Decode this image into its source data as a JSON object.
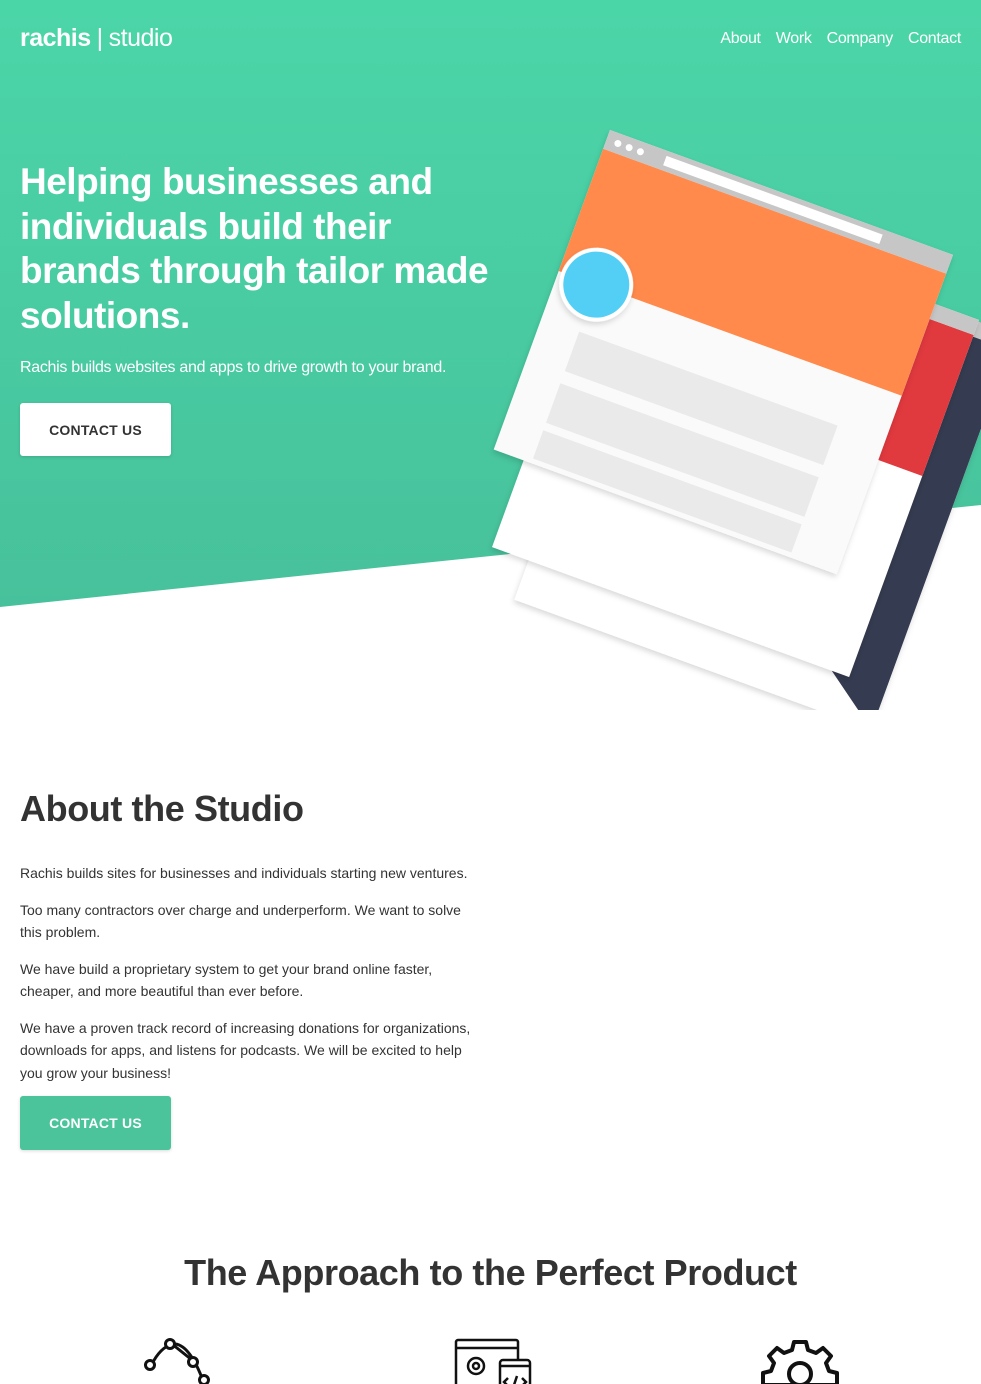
{
  "brand": {
    "name_bold": "rachis",
    "separator": "|",
    "name_light": "studio"
  },
  "nav": {
    "items": [
      {
        "label": "About"
      },
      {
        "label": "Work"
      },
      {
        "label": "Company"
      },
      {
        "label": "Contact"
      }
    ]
  },
  "hero": {
    "title": "Helping businesses and individuals build their brands through tailor made solutions.",
    "subtitle": "Rachis builds websites and apps to drive growth to your brand.",
    "cta_label": "CONTACT US"
  },
  "about": {
    "title": "About the Studio",
    "paragraphs": [
      "Rachis builds sites for businesses and individuals starting new ventures.",
      "Too many contractors over charge and underperform. We want to solve this problem.",
      "We have build a proprietary system to get your brand online faster, cheaper, and more beautiful than ever before.",
      "We have a proven track record of increasing donations for organizations, downloads for apps, and listens for podcasts. We will be excited to help you grow your business!"
    ],
    "cta_label": "CONTACT US"
  },
  "approach": {
    "title": "The Approach to the Perfect Product",
    "icons": [
      "bezier-curve-icon",
      "code-settings-icon",
      "gear-icon"
    ]
  },
  "colors": {
    "hero_green_top": "#4bd6a8",
    "hero_green_bottom": "#47c19b",
    "button_green": "#4bc49b",
    "illustration_orange": "#ff8a4c",
    "illustration_red": "#e0393e",
    "illustration_navy": "#353b50",
    "illustration_blue": "#53cff5",
    "text_dark": "#333333"
  }
}
